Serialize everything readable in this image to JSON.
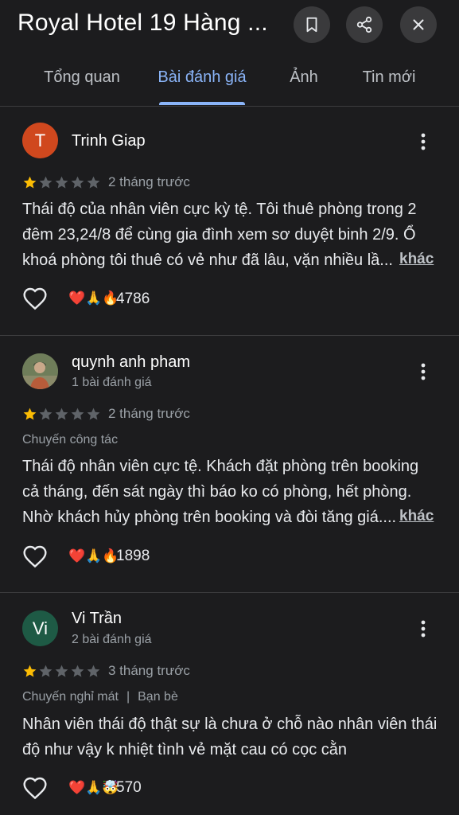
{
  "header": {
    "title": "Royal Hotel 19 Hàng ...",
    "icons": [
      "bookmark-icon",
      "share-icon",
      "close-icon"
    ]
  },
  "tabs": [
    {
      "label": "Tổng quan",
      "active": false
    },
    {
      "label": "Bài đánh giá",
      "active": true
    },
    {
      "label": "Ảnh",
      "active": false
    },
    {
      "label": "Tin mới",
      "active": false
    }
  ],
  "colors": {
    "accent": "#8ab4f8",
    "star_filled": "#fbbc04",
    "star_empty": "#5f6368"
  },
  "reviews": [
    {
      "avatar_letter": "T",
      "avatar_color": "#d0481e",
      "name": "Trinh Giap",
      "sub": "",
      "rating": 1,
      "time": "2 tháng trước",
      "trip": "",
      "lines": [
        "Thái độ của nhân viên cực kỳ tệ. Tôi thuê phòng trong 2",
        "đêm 23,24/8 để cùng gia đình xem sơ duyệt binh 2/9. Ổ",
        "khoá phòng tôi thuê có vẻ như đã lâu, vặn nhiều lầ..."
      ],
      "more": "khác",
      "reactions": "❤️🙏🔥",
      "count": "4786"
    },
    {
      "avatar_letter": "",
      "avatar_color": "#5b6b4a",
      "name": "quynh anh pham",
      "sub": "1 bài đánh giá",
      "rating": 1,
      "time": "2 tháng trước",
      "trip": "Chuyến công tác",
      "lines": [
        "Thái độ nhân viên cực tệ. Khách đặt phòng trên booking",
        "cả tháng, đến sát ngày thì báo ko có phòng, hết phòng.",
        "Nhờ khách hủy phòng trên booking và đòi tăng giá...."
      ],
      "more": "khác",
      "reactions": "❤️🙏🔥",
      "count": "1898"
    },
    {
      "avatar_letter": "Vi",
      "avatar_color": "#1e5a45",
      "name": "Vi Trần",
      "sub": "2 bài đánh giá",
      "rating": 1,
      "time": "3 tháng trước",
      "trip": "Chuyến nghỉ mát",
      "trip2": "Bạn bè",
      "lines": [
        "Nhân viên thái độ thật sự là chưa ở chỗ nào nhân viên thái",
        "độ như vậy k nhiệt tình vẻ mặt cau có cọc cằn"
      ],
      "more": "",
      "reactions": "❤️🙏🤯",
      "count": "570"
    }
  ]
}
